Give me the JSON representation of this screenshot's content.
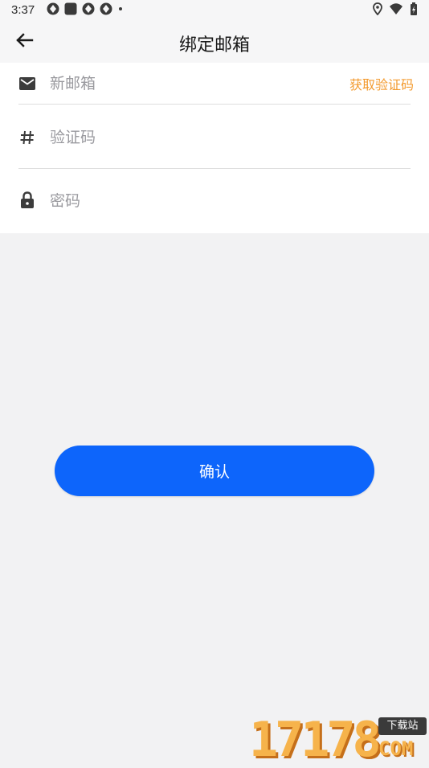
{
  "status_bar": {
    "time": "3:37",
    "left_icons": [
      "aperture-icon",
      "square-app-icon",
      "aperture-icon",
      "aperture-icon",
      "dot-icon"
    ],
    "right_icons": [
      "location-icon",
      "wifi-icon",
      "battery-icon"
    ]
  },
  "app_bar": {
    "back_icon": "arrow-left-icon",
    "title": "绑定邮箱"
  },
  "form": {
    "email": {
      "icon": "mail-icon",
      "placeholder": "新邮箱",
      "value": ""
    },
    "get_code_label": "获取验证码",
    "code": {
      "icon": "hash-icon",
      "placeholder": "验证码",
      "value": ""
    },
    "password": {
      "icon": "lock-icon",
      "placeholder": "密码",
      "value": ""
    }
  },
  "confirm_label": "确认",
  "watermark": {
    "digits": "17178",
    "tag": "下载站",
    "com": "COM"
  },
  "colors": {
    "accent": "#0D65FB",
    "link": "#F39A2E",
    "background": "#F2F2F3",
    "card": "#FFFFFF"
  }
}
